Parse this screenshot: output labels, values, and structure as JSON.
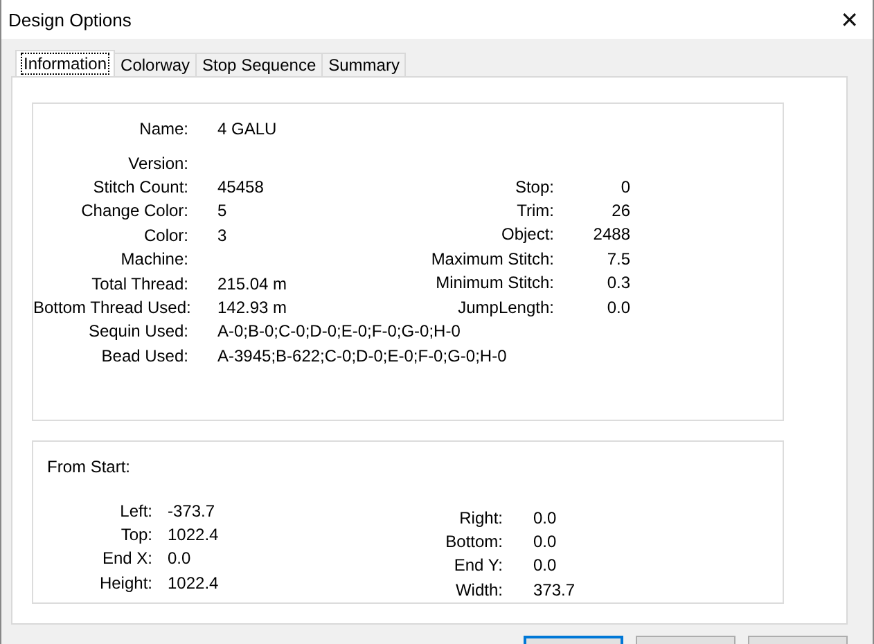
{
  "window": {
    "title": "Design Options",
    "close": "✕"
  },
  "tabs": [
    {
      "label": "Information",
      "selected": true
    },
    {
      "label": "Colorway",
      "selected": false
    },
    {
      "label": "Stop Sequence",
      "selected": false
    },
    {
      "label": "Summary",
      "selected": false
    }
  ],
  "design_info": {
    "left": [
      {
        "label": "Name:",
        "value": "4 GALU"
      },
      {
        "label": "Version:"
      },
      {
        "label": "Stitch Count:",
        "value": "45458"
      },
      {
        "label": "Change Color:",
        "value": "5"
      },
      {
        "label": "Color:",
        "value": "3"
      },
      {
        "label": "Machine:"
      },
      {
        "label": "Total Thread:",
        "value": "215.04 m"
      },
      {
        "label": "Bottom Thread Used:",
        "value": "142.93 m"
      },
      {
        "label": "Sequin Used:",
        "value": "A-0;B-0;C-0;D-0;E-0;F-0;G-0;H-0"
      },
      {
        "label": "Bead Used:",
        "value": "A-3945;B-622;C-0;D-0;E-0;F-0;G-0;H-0"
      }
    ],
    "right": [
      {
        "label": "Stop:",
        "value": "0"
      },
      {
        "label": "Trim:",
        "value": "26"
      },
      {
        "label": "Object:",
        "value": "2488"
      },
      {
        "label": "Maximum Stitch:",
        "value": "7.5"
      },
      {
        "label": "Minimum Stitch:",
        "value": "0.3"
      },
      {
        "label": "JumpLength:",
        "value": "0.0"
      }
    ]
  },
  "from_start": {
    "title": "From Start:",
    "left": [
      {
        "label": "Left:",
        "value": "-373.7"
      },
      {
        "label": "Top:",
        "value": "1022.4"
      },
      {
        "label": "End X:",
        "value": "0.0"
      },
      {
        "label": "Height:",
        "value": "1022.4"
      }
    ],
    "right": [
      {
        "label": "Right:",
        "value": "0.0"
      },
      {
        "label": "Bottom:",
        "value": "0.0"
      },
      {
        "label": "End Y:",
        "value": "0.0"
      },
      {
        "label": "Width:",
        "value": "373.7"
      }
    ]
  },
  "bottom_buttons": [
    {
      "default": true
    },
    {
      "default": false
    },
    {
      "default": false
    }
  ]
}
